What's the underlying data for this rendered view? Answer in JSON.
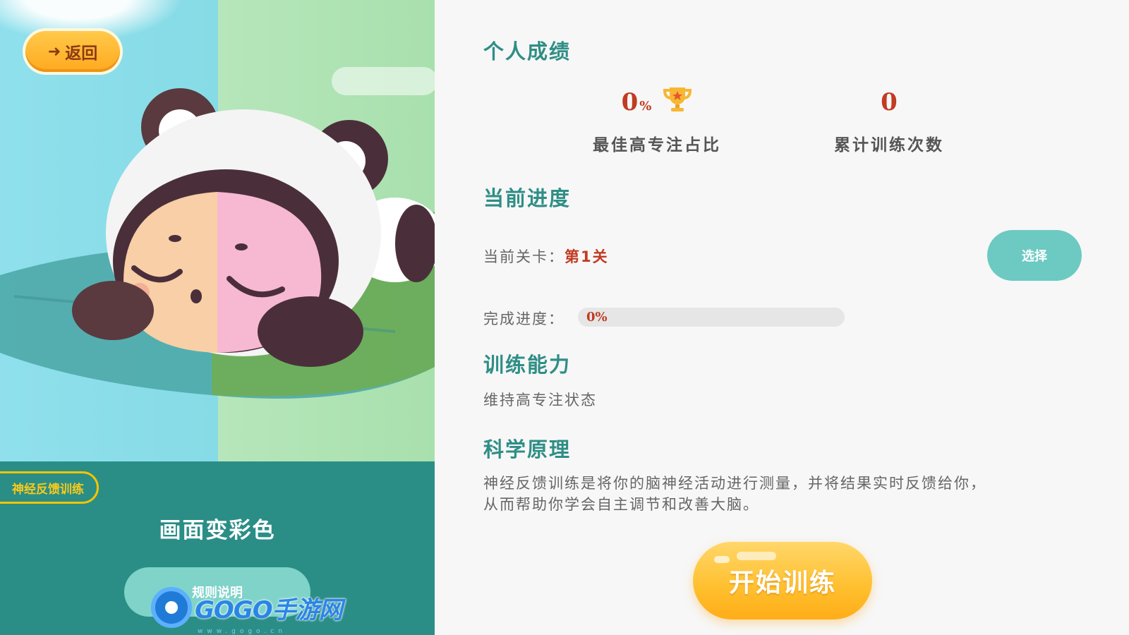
{
  "left": {
    "back_label": "返回",
    "tag_label": "神经反馈训练",
    "game_title": "画面变彩色",
    "rules_label": "规则说明",
    "watermark_text": "GOGO手游网",
    "watermark_sub": "www.gogo.cn"
  },
  "achievements": {
    "title": "个人成绩",
    "best_focus_value": "0",
    "best_focus_unit": "%",
    "best_focus_label": "最佳高专注占比",
    "train_count_value": "0",
    "train_count_label": "累计训练次数"
  },
  "progress": {
    "title": "当前进度",
    "level_label": "当前关卡：",
    "level_value": "第1关",
    "select_label": "选择",
    "completion_label": "完成进度：",
    "completion_text": "0%",
    "completion_fraction": 0
  },
  "ability": {
    "title": "训练能力",
    "text": "维持高专注状态"
  },
  "science": {
    "title": "科学原理",
    "line1": "神经反馈训练是将你的脑神经活动进行测量，并将结果实时反馈给你，",
    "line2": "从而帮助你学会自主调节和改善大脑。"
  },
  "start_label": "开始训练",
  "colors": {
    "teal": "#2f8e86",
    "accent_red": "#c23b22",
    "button_yellow": "#ffbf2e",
    "select_teal": "#6ccac2"
  }
}
